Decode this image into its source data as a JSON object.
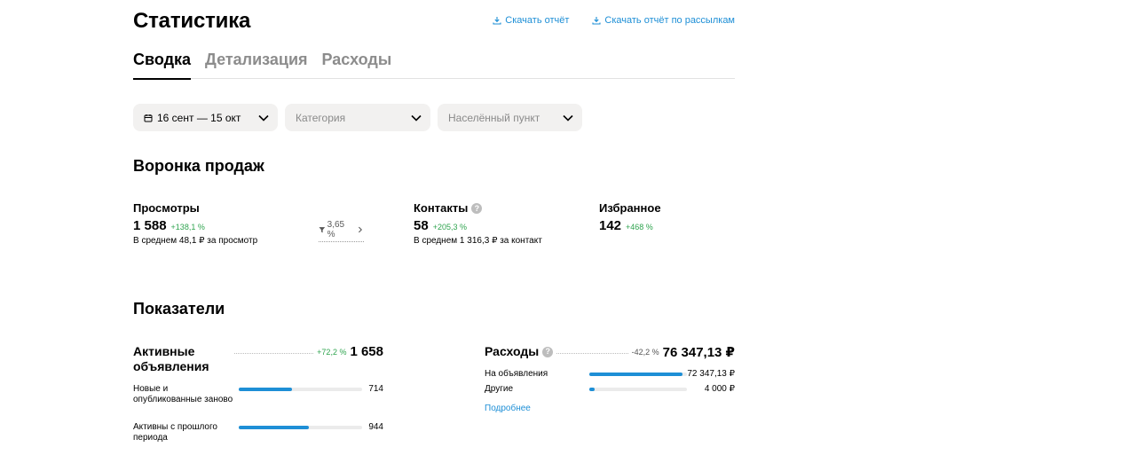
{
  "header": {
    "title": "Статистика",
    "links": [
      {
        "label": "Скачать отчёт",
        "icon": "download-icon"
      },
      {
        "label": "Скачать отчёт по рассылкам",
        "icon": "download-icon"
      }
    ]
  },
  "tabs": [
    {
      "label": "Сводка",
      "active": true
    },
    {
      "label": "Детализация",
      "active": false
    },
    {
      "label": "Расходы",
      "active": false
    }
  ],
  "filters": {
    "date": {
      "value": "16 сент — 15 окт",
      "icon": "calendar-icon"
    },
    "category": {
      "placeholder": "Категория"
    },
    "city": {
      "placeholder": "Населённый пункт"
    }
  },
  "funnel": {
    "title": "Воронка продаж",
    "views": {
      "label": "Просмотры",
      "value": "1 588",
      "delta": "+138,1 %",
      "sub": "В среднем 48,1 ₽ за просмотр"
    },
    "conversion": {
      "value": "3,65 %",
      "icon": "funnel-icon"
    },
    "contacts": {
      "label": "Контакты",
      "value": "58",
      "delta": "+205,3 %",
      "sub": "В среднем 1 316,3 ₽ за контакт"
    },
    "favorites": {
      "label": "Избранное",
      "value": "142",
      "delta": "+468 %"
    }
  },
  "metrics": {
    "title": "Показатели",
    "active_ads": {
      "label": "Активные объявления",
      "delta": "+72,2 %",
      "value": "1 658",
      "rows": [
        {
          "label": "Новые и опубликованные заново",
          "value": "714",
          "fraction": 0.43
        },
        {
          "label": "Активны с прошлого периода",
          "value": "944",
          "fraction": 0.57
        }
      ]
    },
    "expenses": {
      "label": "Расходы",
      "delta": "-42,2 %",
      "value": "76 347,13 ₽",
      "rows": [
        {
          "label": "На объявления",
          "value": "72 347,13 ₽",
          "fraction": 0.95
        },
        {
          "label": "Другие",
          "value": "4 000 ₽",
          "fraction": 0.05
        }
      ],
      "more": "Подробнее"
    }
  },
  "colors": {
    "accent": "#1e8fd6",
    "positive": "#2fa44f",
    "filter_bg": "#f2f1f0"
  }
}
